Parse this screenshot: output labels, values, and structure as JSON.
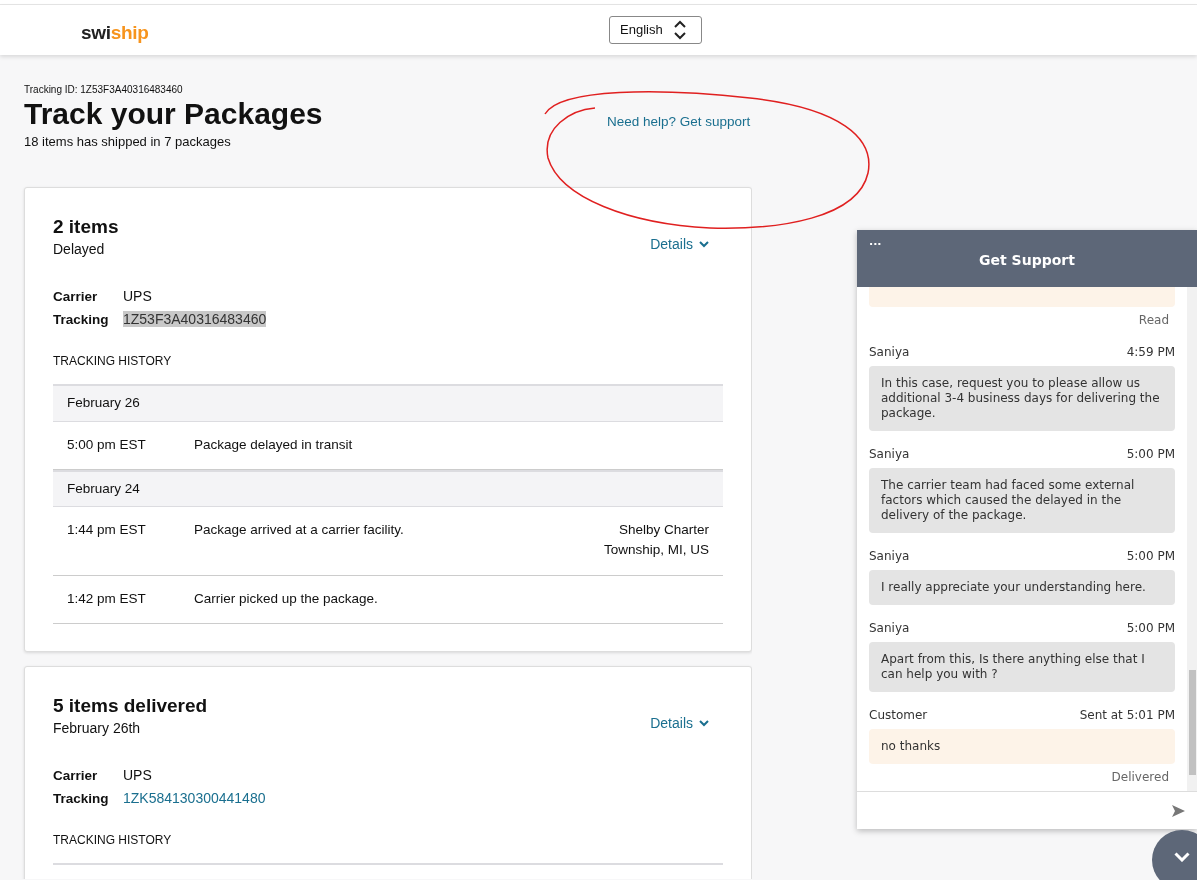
{
  "header": {
    "logo": [
      {
        "text": "swi",
        "color": "#222222"
      },
      {
        "text": "ship",
        "color": "#f7941d"
      }
    ],
    "language": "English"
  },
  "tracking_id": "Tracking ID: 1Z53F3A40316483460",
  "title": "Track your Packages",
  "summary": "18 items has shipped in 7 packages",
  "help_link": "Need help? Get support",
  "packages": [
    {
      "title": "2 items",
      "status": "Delayed",
      "details": "Details",
      "carrier_label": "Carrier",
      "carrier": "UPS",
      "tracking_label": "Tracking",
      "tracking": "1Z53F3A40316483460",
      "tracking_highlighted": true,
      "history_label": "TRACKING HISTORY",
      "history": [
        {
          "date": "February 26",
          "events": [
            {
              "time": "5:00 pm EST",
              "description": "Package delayed in transit"
            }
          ]
        },
        {
          "date": "February 24",
          "events": [
            {
              "time": "1:44 pm EST",
              "description": "Package arrived at a carrier facility.",
              "location": "Shelby Charter Township, MI, US"
            },
            {
              "time": "1:42 pm EST",
              "description": "Carrier picked up the package."
            }
          ]
        }
      ]
    },
    {
      "title": "5 items delivered",
      "status": "February 26th",
      "details": "Details",
      "carrier_label": "Carrier",
      "carrier": "UPS",
      "tracking_label": "Tracking",
      "tracking": "1ZK584130300441480",
      "tracking_highlighted": false,
      "history_label": "TRACKING HISTORY"
    }
  ],
  "chat": {
    "menu": "...",
    "title": "Get Support",
    "messages": [
      {
        "kind": "customer",
        "status": "Read"
      },
      {
        "kind": "agent",
        "sender": "Saniya",
        "time": "4:59 PM",
        "text": "In this case, request you to please allow us additional 3-4 business days for delivering the package."
      },
      {
        "kind": "agent",
        "sender": "Saniya",
        "time": "5:00 PM",
        "text": "The carrier team had faced some external factors which caused the delayed in the delivery of the package."
      },
      {
        "kind": "agent",
        "sender": "Saniya",
        "time": "5:00 PM",
        "text": "I really appreciate your understanding here."
      },
      {
        "kind": "agent",
        "sender": "Saniya",
        "time": "5:00 PM",
        "text": "Apart from this, Is there anything else that I can help you with ?"
      },
      {
        "kind": "customer",
        "sender": "Customer",
        "time": "Sent at 5:01 PM",
        "text": "no thanks",
        "status": "Delivered"
      }
    ]
  }
}
